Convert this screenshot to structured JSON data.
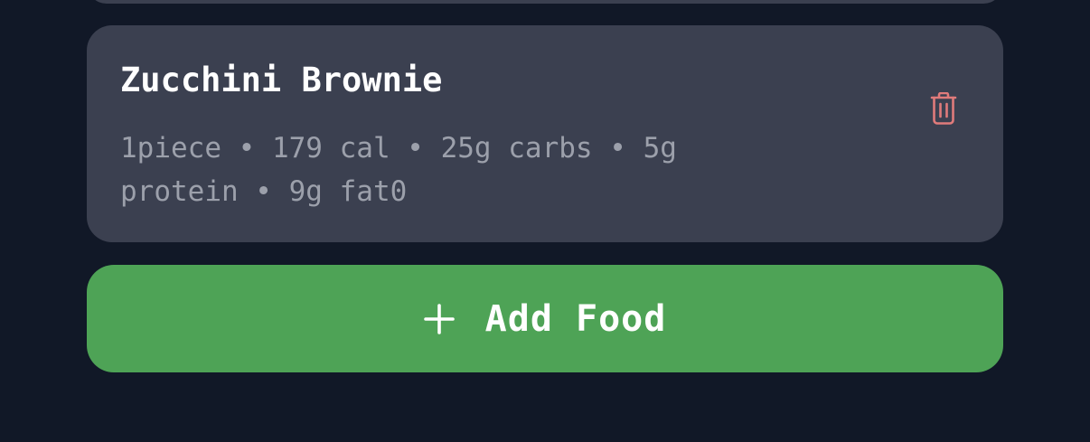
{
  "food_entries": [
    {
      "name": "Zucchini Brownie",
      "details": "1piece • 179 cal • 25g carbs • 5g protein • 9g fat0",
      "delete_icon": "trash-icon"
    }
  ],
  "actions": {
    "add_food_label": "Add Food",
    "add_icon": "plus-icon"
  },
  "colors": {
    "background": "#111827",
    "card": "#3b4050",
    "accent_green": "#4ea356",
    "delete_red": "#e07b7b",
    "text_primary": "#ffffff",
    "text_secondary": "#9ca0ab"
  }
}
